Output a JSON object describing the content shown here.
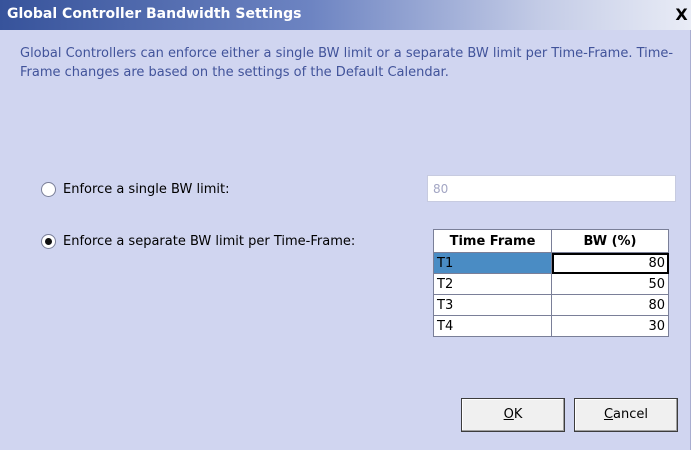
{
  "window": {
    "title": "Global Controller Bandwidth Settings",
    "close_glyph": "X"
  },
  "description": "Global Controllers can enforce either a single BW limit or a separate BW limit per Time-Frame. Time-Frame changes are based on the settings of the Default Calendar.",
  "options": {
    "single": {
      "label": "Enforce a single BW limit:",
      "checked": false,
      "value": "80"
    },
    "separate": {
      "label": "Enforce a separate BW limit per Time-Frame:",
      "checked": true
    }
  },
  "table": {
    "headers": [
      "Time Frame",
      "BW (%)"
    ],
    "rows": [
      {
        "name": "T1",
        "bw": "80",
        "selected": true
      },
      {
        "name": "T2",
        "bw": "50",
        "selected": false
      },
      {
        "name": "T3",
        "bw": "80",
        "selected": false
      },
      {
        "name": "T4",
        "bw": "30",
        "selected": false
      }
    ]
  },
  "buttons": {
    "ok": {
      "mnemonic": "O",
      "rest": "K"
    },
    "cancel": {
      "mnemonic": "C",
      "rest": "ancel"
    }
  }
}
